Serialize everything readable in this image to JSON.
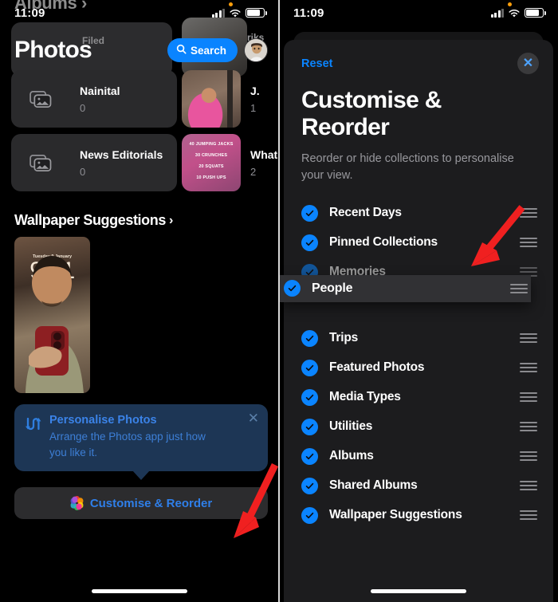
{
  "status_bar": {
    "time": "11:09",
    "cellular_icon": "signal-bars-icon",
    "wifi_icon": "wifi-icon",
    "battery_icon": "battery-icon"
  },
  "left_screen": {
    "cut_off_title": "Albums",
    "page_title": "Photos",
    "search_label": "Search",
    "search_icon": "magnifier-icon",
    "avatar": "profile-avatar",
    "ghost_label": "Filed",
    "albums": [
      {
        "name": "Nainital",
        "count": "0",
        "icon": "photo-stack-icon"
      },
      {
        "name": "J.",
        "count": "1",
        "thumbnail": "baby-photo-thumbnail"
      },
      {
        "name": "News Editorials",
        "count": "0",
        "icon": "photo-stack-icon"
      },
      {
        "name": "Whats",
        "count": "2",
        "thumbnail": "workout-poster-thumbnail"
      }
    ],
    "workout_lines": [
      "40 JUMPING JACKS",
      "30 CRUNCHES",
      "20 SQUATS",
      "10 PUSH UPS"
    ],
    "section_title": "Wallpaper Suggestions",
    "section_chevron": "chevron-right-icon",
    "wallpaper": {
      "date": "Tuesday 9 January",
      "time": "9:41"
    },
    "tip": {
      "icon": "reorder-arrows-icon",
      "title": "Personalise Photos",
      "body": "Arrange the Photos app just how you like it.",
      "close_icon": "close-icon"
    },
    "customise_button": {
      "label": "Customise & Reorder",
      "icon": "photos-flower-icon"
    }
  },
  "right_screen": {
    "reset_label": "Reset",
    "close_icon": "close-icon",
    "title": "Customise & Reorder",
    "subtitle": "Reorder or hide collections to personalise your view.",
    "collections": [
      {
        "label": "Recent Days",
        "checked": true,
        "state": "normal"
      },
      {
        "label": "Pinned Collections",
        "checked": true,
        "state": "normal"
      },
      {
        "label": "Memories",
        "checked": true,
        "state": "dimmed"
      },
      {
        "label": "People",
        "checked": true,
        "state": "dragging"
      },
      {
        "label": "Trips",
        "checked": true,
        "state": "normal"
      },
      {
        "label": "Featured Photos",
        "checked": true,
        "state": "normal"
      },
      {
        "label": "Media Types",
        "checked": true,
        "state": "normal"
      },
      {
        "label": "Utilities",
        "checked": true,
        "state": "normal"
      },
      {
        "label": "Albums",
        "checked": true,
        "state": "normal"
      },
      {
        "label": "Shared Albums",
        "checked": true,
        "state": "normal"
      },
      {
        "label": "Wallpaper Suggestions",
        "checked": true,
        "state": "normal"
      }
    ],
    "check_icon": "checkmark-circle-icon",
    "drag_handle_icon": "drag-handle-icon"
  },
  "annotations": {
    "arrow_color": "#f02020",
    "arrows": [
      "arrow-pointing-to-customise-reorder-button",
      "arrow-pointing-to-drag-handle"
    ]
  },
  "colors": {
    "accent_blue": "#0a84ff",
    "sheet_bg": "#1c1c1e",
    "card_bg": "#2c2c2e",
    "annotation_red": "#f02020"
  }
}
